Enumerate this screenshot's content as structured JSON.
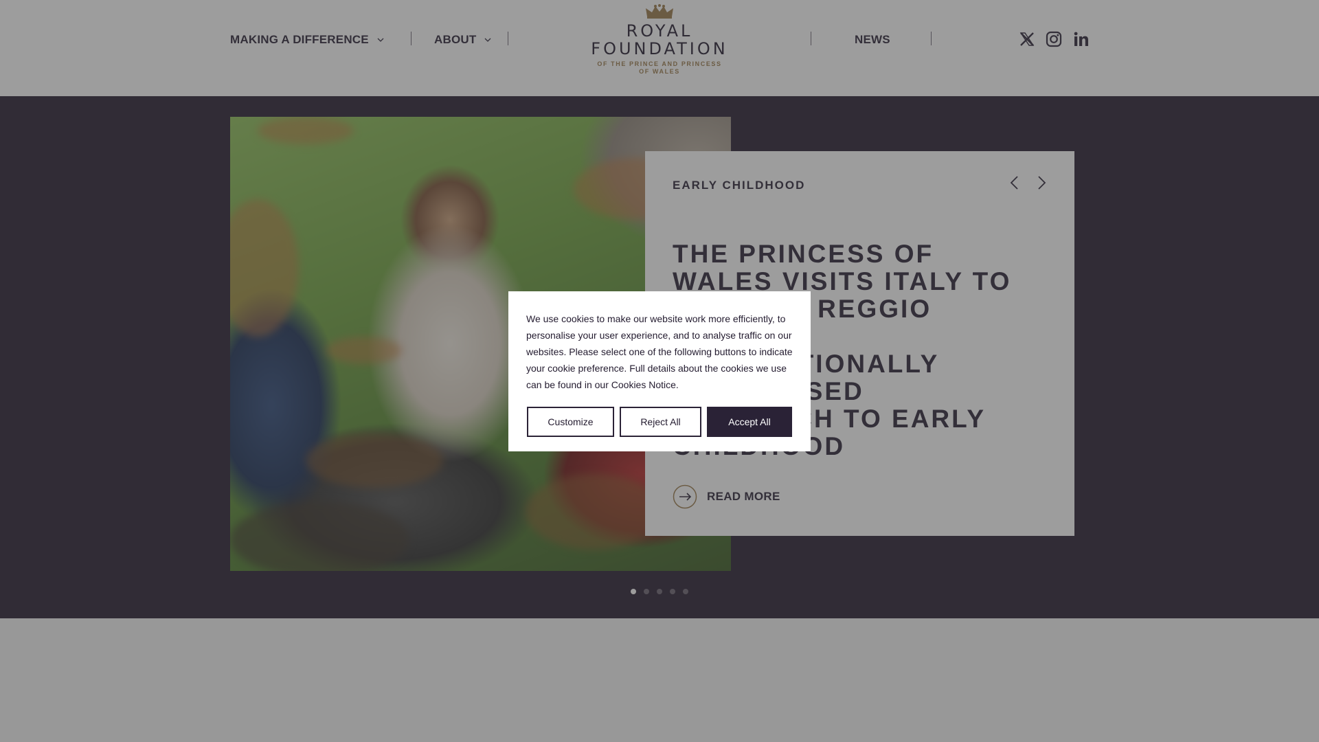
{
  "header": {
    "nav_left": [
      {
        "label": "MAKING A DIFFERENCE",
        "has_dropdown": true
      },
      {
        "label": "ABOUT",
        "has_dropdown": true
      }
    ],
    "nav_right": [
      {
        "label": "NEWS"
      }
    ],
    "logo": {
      "line1": "ROYAL",
      "line2": "FOUNDATION",
      "line3": "OF THE PRINCE AND PRINCESS",
      "line4": "OF WALES",
      "icon": "crown-icon"
    },
    "social": [
      "x-twitter-icon",
      "instagram-icon",
      "linkedin-icon"
    ]
  },
  "hero": {
    "photo_alt": "The Princess of Wales with children outdoors",
    "card": {
      "category": "EARLY CHILDHOOD",
      "headline": "THE PRINCESS OF WALES VISITS ITALY TO EXPLORE REGGIO EMILIA'S INTERNATIONALLY RECOGNISED APPROACH TO EARLY CHILDHOOD",
      "read_more": "READ MORE",
      "prev_icon": "chevron-left-icon",
      "next_icon": "chevron-right-icon"
    },
    "slides_count": 5,
    "active_slide": 1
  },
  "cookie_banner": {
    "text": "We use cookies to make our website work more efficiently, to personalise your user experience, and to analyse traffic on our websites. Please select one of the following buttons to indicate your cookie preference. Full details about the cookies we use can be found in our Cookies Notice.",
    "buttons": {
      "customize": "Customize",
      "reject": "Reject All",
      "accept": "Accept All"
    }
  },
  "colors": {
    "brand_dark": "#2a2236",
    "hero_bg": "#261c30",
    "gold": "#9a7a4a"
  }
}
